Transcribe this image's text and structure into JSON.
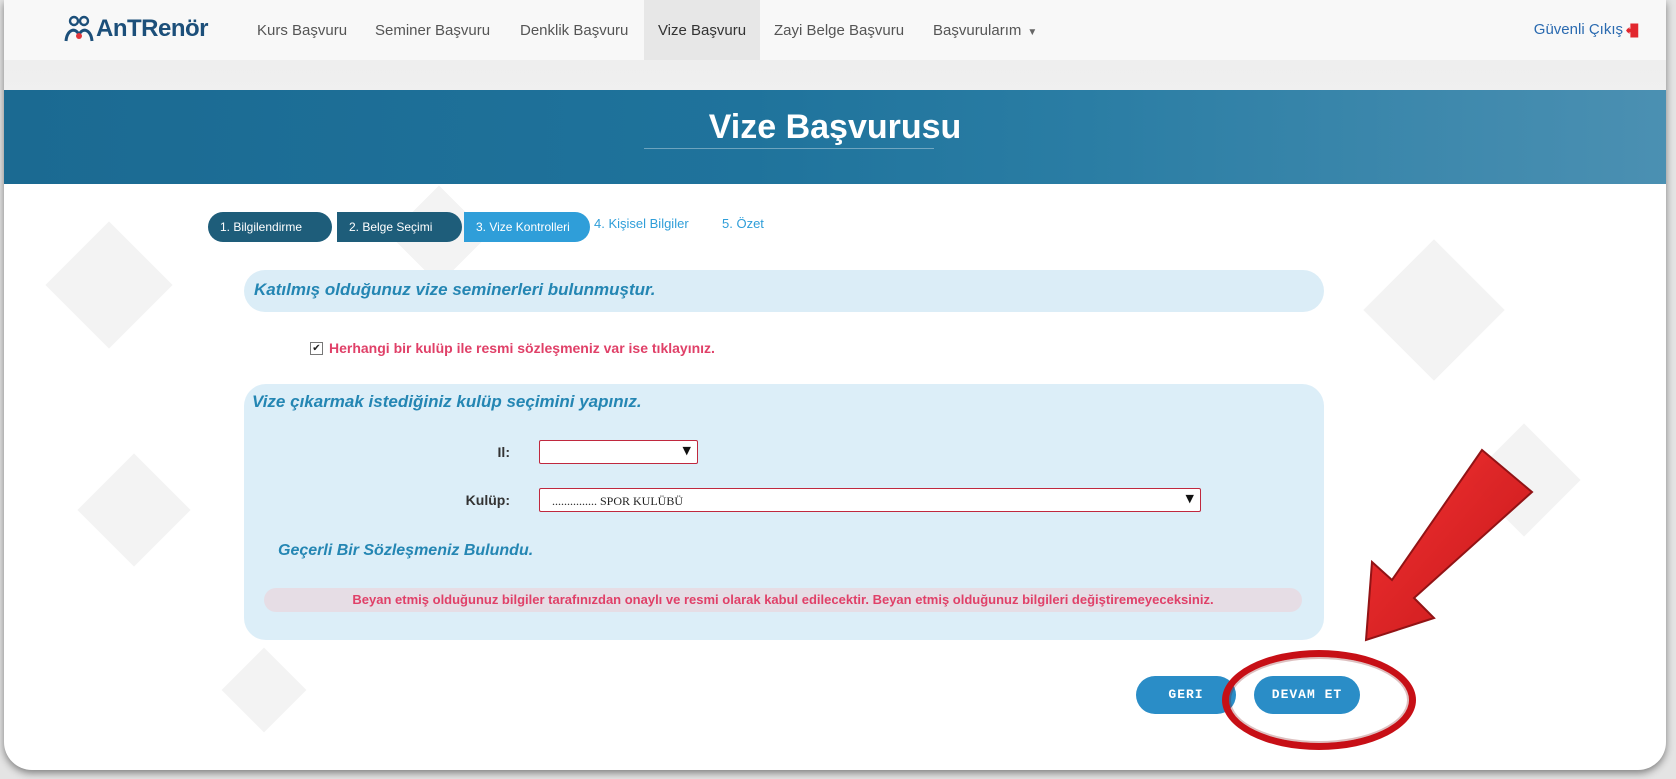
{
  "navbar": {
    "logo_text": "AnTRenör",
    "items": [
      {
        "label": "Kurs Başvuru"
      },
      {
        "label": "Seminer Başvuru"
      },
      {
        "label": "Denklik Başvuru"
      },
      {
        "label": "Vize Başvuru",
        "active": true
      },
      {
        "label": "Zayi Belge Başvuru"
      },
      {
        "label": "Başvurularım"
      }
    ],
    "logout_label": "Güvenli Çıkış"
  },
  "banner": {
    "title": "Vize Başvurusu"
  },
  "steps": [
    {
      "label": "1. Bilgilendirme",
      "state": "done"
    },
    {
      "label": "2. Belge Seçimi",
      "state": "done"
    },
    {
      "label": "3. Vize Kontrolleri",
      "state": "current"
    },
    {
      "label": "4. Kişisel Bilgiler",
      "state": "todo"
    },
    {
      "label": "5. Özet",
      "state": "todo"
    }
  ],
  "info": {
    "text": "Katılmış olduğunuz vize seminerleri bulunmuştur."
  },
  "contract_checkbox": {
    "checked": true,
    "label": "Herhangi bir kulüp ile resmi sözleşmeniz var ise tıklayınız."
  },
  "club_form": {
    "heading": "Vize çıkarmak istediğiniz kulüp seçimini yapınız.",
    "il_label": "Il:",
    "il_value": "",
    "kulup_label": "Kulüp:",
    "kulup_value": "............... SPOR KULÜBÜ",
    "found_text": "Geçerli Bir Sözleşmeniz Bulundu.",
    "warning_text": "Beyan etmiş olduğunuz bilgiler tarafınızdan onaylı ve resmi olarak kabul edilecektir. Beyan etmiş olduğunuz bilgileri değiştiremeyeceksiniz."
  },
  "buttons": {
    "back_label": "GERI",
    "continue_label": "DEVAM ET"
  },
  "colors": {
    "brand_blue": "#1c4f7a",
    "banner": "#1f739c",
    "step_done": "#1e5d7a",
    "step_current": "#2f9ed9",
    "panel_bg": "#dceef8",
    "warning_text": "#e04068",
    "button": "#2a8dc7",
    "annotation_red": "#c70f16"
  },
  "icons": [
    "people-logo-icon",
    "logout-door-icon",
    "dropdown-caret-icon",
    "select-arrow-icon",
    "checkbox-checked-icon",
    "annotation-arrow",
    "annotation-circle"
  ]
}
